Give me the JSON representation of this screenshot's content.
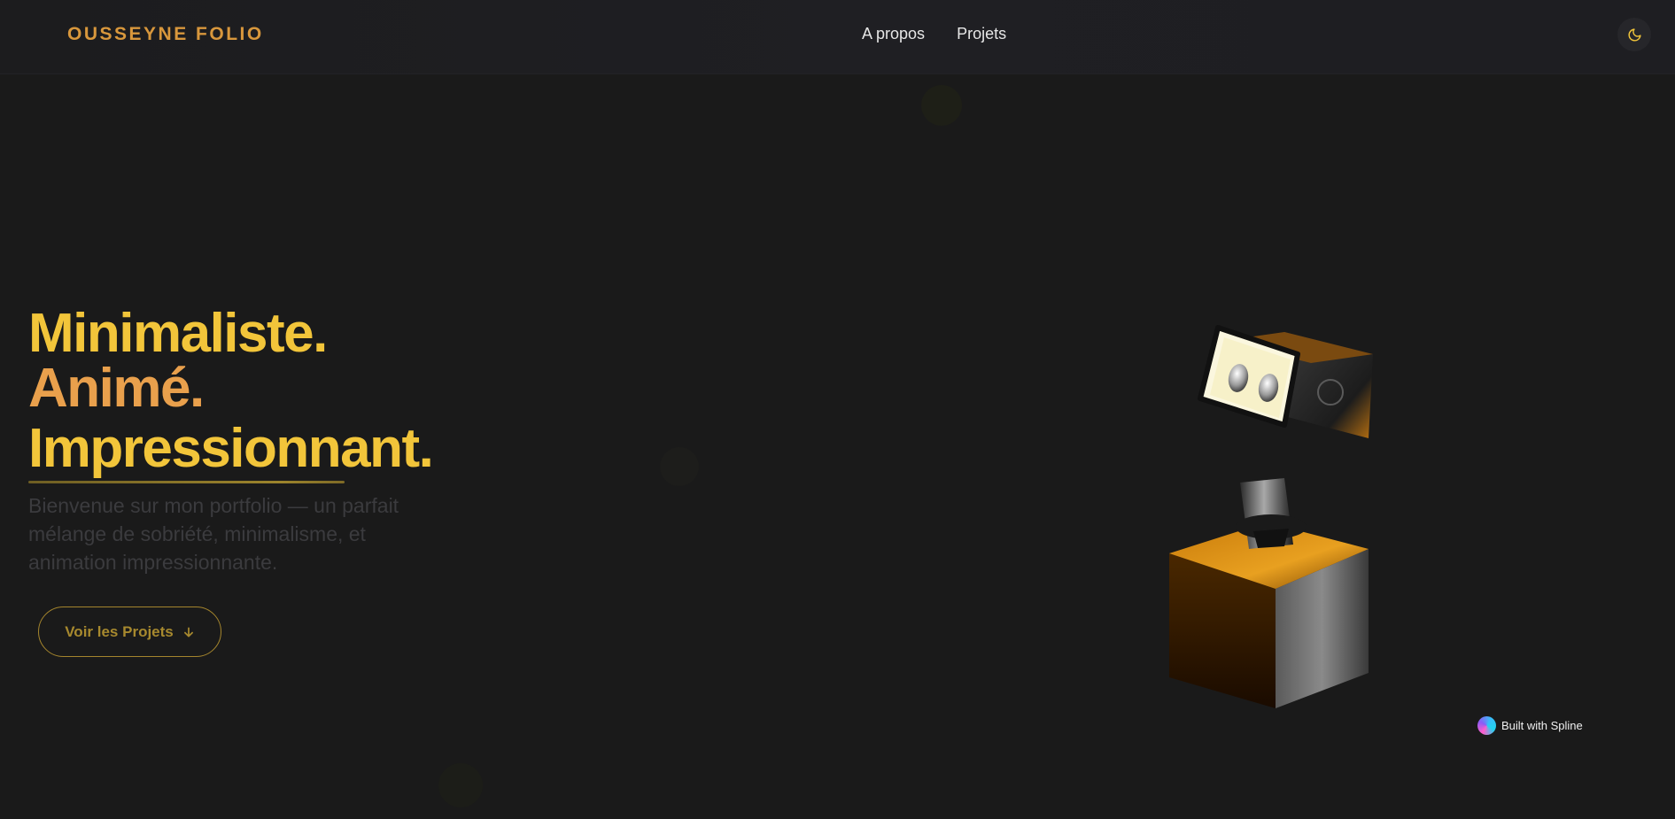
{
  "header": {
    "brand": "OUSSEYNE FOLIO",
    "nav": [
      "A propos",
      "Projets"
    ],
    "theme_icon": "moon-icon"
  },
  "hero": {
    "line1": "Minimaliste.",
    "line2": "Animé.",
    "line3": "Impressionnant.",
    "description": "Bienvenue sur mon portfolio — un parfait mélange de sobriété, minimalisme, et animation impressionnante.",
    "cta_label": "Voir les Projets",
    "cta_icon": "arrow-down-icon"
  },
  "spline": {
    "badge_label": "Built with Spline"
  },
  "colors": {
    "background": "#1a1a1a",
    "brand": "#d8973c",
    "accent_yellow": "#f2c53a",
    "accent_orange": "#e9a04c",
    "cta_border": "#a4852d"
  }
}
